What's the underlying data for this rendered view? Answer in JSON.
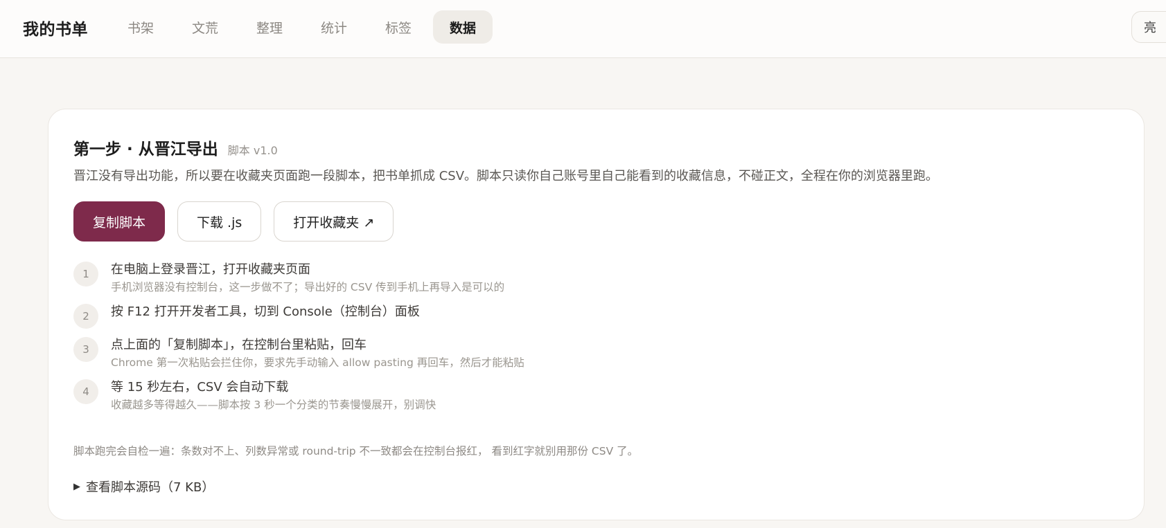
{
  "header": {
    "brand": "我的书单",
    "nav": [
      {
        "label": "书架"
      },
      {
        "label": "文荒"
      },
      {
        "label": "整理"
      },
      {
        "label": "统计"
      },
      {
        "label": "标签"
      },
      {
        "label": "数据",
        "active": true
      }
    ],
    "theme_toggle": "亮"
  },
  "card": {
    "title": "第一步 · 从晋江导出",
    "version": "脚本 v1.0",
    "description": "晋江没有导出功能，所以要在收藏夹页面跑一段脚本，把书单抓成 CSV。脚本只读你自己账号里自己能看到的收藏信息，不碰正文，全程在你的浏览器里跑。",
    "buttons": {
      "copy": "复制脚本",
      "download": "下载 .js",
      "open": "打开收藏夹 ↗"
    },
    "steps": [
      {
        "num": "1",
        "title": "在电脑上登录晋江，打开收藏夹页面",
        "note": "手机浏览器没有控制台，这一步做不了；导出好的 CSV 传到手机上再导入是可以的"
      },
      {
        "num": "2",
        "title": "按 F12 打开开发者工具，切到 Console（控制台）面板",
        "note": ""
      },
      {
        "num": "3",
        "title": "点上面的「复制脚本」，在控制台里粘贴，回车",
        "note": "Chrome 第一次粘贴会拦住你，要求先手动输入 allow pasting 再回车，然后才能粘贴"
      },
      {
        "num": "4",
        "title": "等 15 秒左右，CSV 会自动下载",
        "note": "收藏越多等得越久——脚本按 3 秒一个分类的节奏慢慢展开，别调快"
      }
    ],
    "footnote": "脚本跑完会自检一遍：条数对不上、列数异常或 round-trip 不一致都会在控制台报红， 看到红字就别用那份 CSV 了。",
    "source_toggle": "查看脚本源码（7 KB）"
  },
  "colors": {
    "accent": "#7e2a4b",
    "background": "#f8f6f3",
    "card": "#ffffff"
  }
}
